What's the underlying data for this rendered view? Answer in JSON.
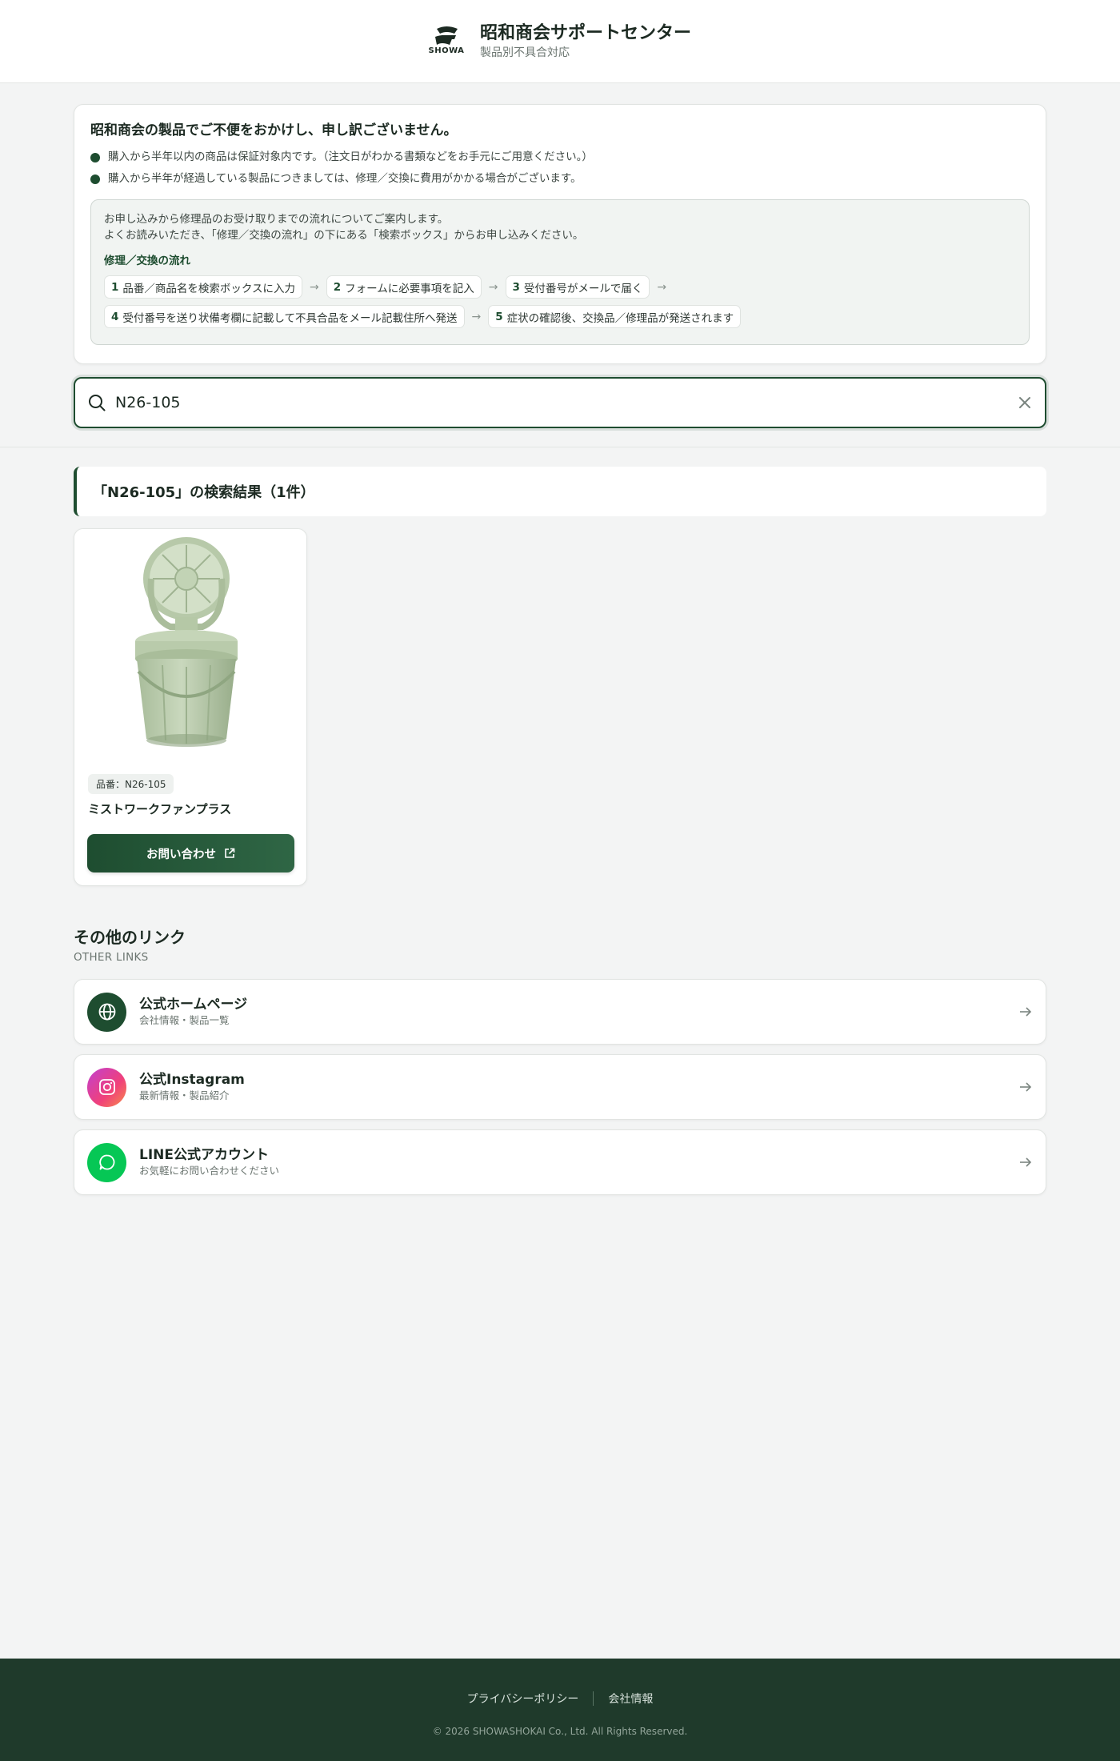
{
  "header": {
    "logo_text": "SHOWA",
    "title": "昭和商会サポートセンター",
    "subtitle": "製品別不具合対応"
  },
  "notice": {
    "title": "昭和商会の製品でご不便をおかけし、申し訳ございません。",
    "bullets": [
      "購入から半年以内の商品は保証対象内です。（注文日がわかる書類などをお手元にご用意ください。）",
      "購入から半年が経過している製品につきましては、修理／交換に費用がかかる場合がございます。"
    ],
    "intro_line1": "お申し込みから修理品のお受け取りまでの流れについてご案内します。",
    "intro_line2": "よくお読みいただき、「修理／交換の流れ」の下にある「検索ボックス」からお申し込みください。",
    "flow_title": "修理／交換の流れ",
    "steps": [
      {
        "num": "1",
        "text": "品番／商品名を検索ボックスに入力"
      },
      {
        "num": "2",
        "text": "フォームに必要事項を記入"
      },
      {
        "num": "3",
        "text": "受付番号がメールで届く"
      },
      {
        "num": "4",
        "text": "受付番号を送り状備考欄に記載して不具合品をメール記載住所へ発送"
      },
      {
        "num": "5",
        "text": "症状の確認後、交換品／修理品が発送されます"
      }
    ]
  },
  "search": {
    "value": "N26-105"
  },
  "results": {
    "heading": "「N26-105」の検索結果（1件）",
    "items": [
      {
        "sku_label": "品番：N26-105",
        "name": "ミストワークファンプラス",
        "button_label": "お問い合わせ"
      }
    ]
  },
  "other_links": {
    "title": "その他のリンク",
    "subtitle": "OTHER LINKS",
    "items": [
      {
        "label": "公式ホームページ",
        "desc": "会社情報・製品一覧",
        "icon": "globe-icon",
        "color": "#1e4d30"
      },
      {
        "label": "公式Instagram",
        "desc": "最新情報・製品紹介",
        "icon": "instagram-icon",
        "color": "#e4407b"
      },
      {
        "label": "LINE公式アカウント",
        "desc": "お気軽にお問い合わせください",
        "icon": "chat-icon",
        "color": "#06c755"
      }
    ]
  },
  "footer": {
    "privacy": "プライバシーポリシー",
    "company": "会社情報",
    "copyright": "© 2026 SHOWASHOKAI Co., Ltd. All Rights Reserved."
  }
}
